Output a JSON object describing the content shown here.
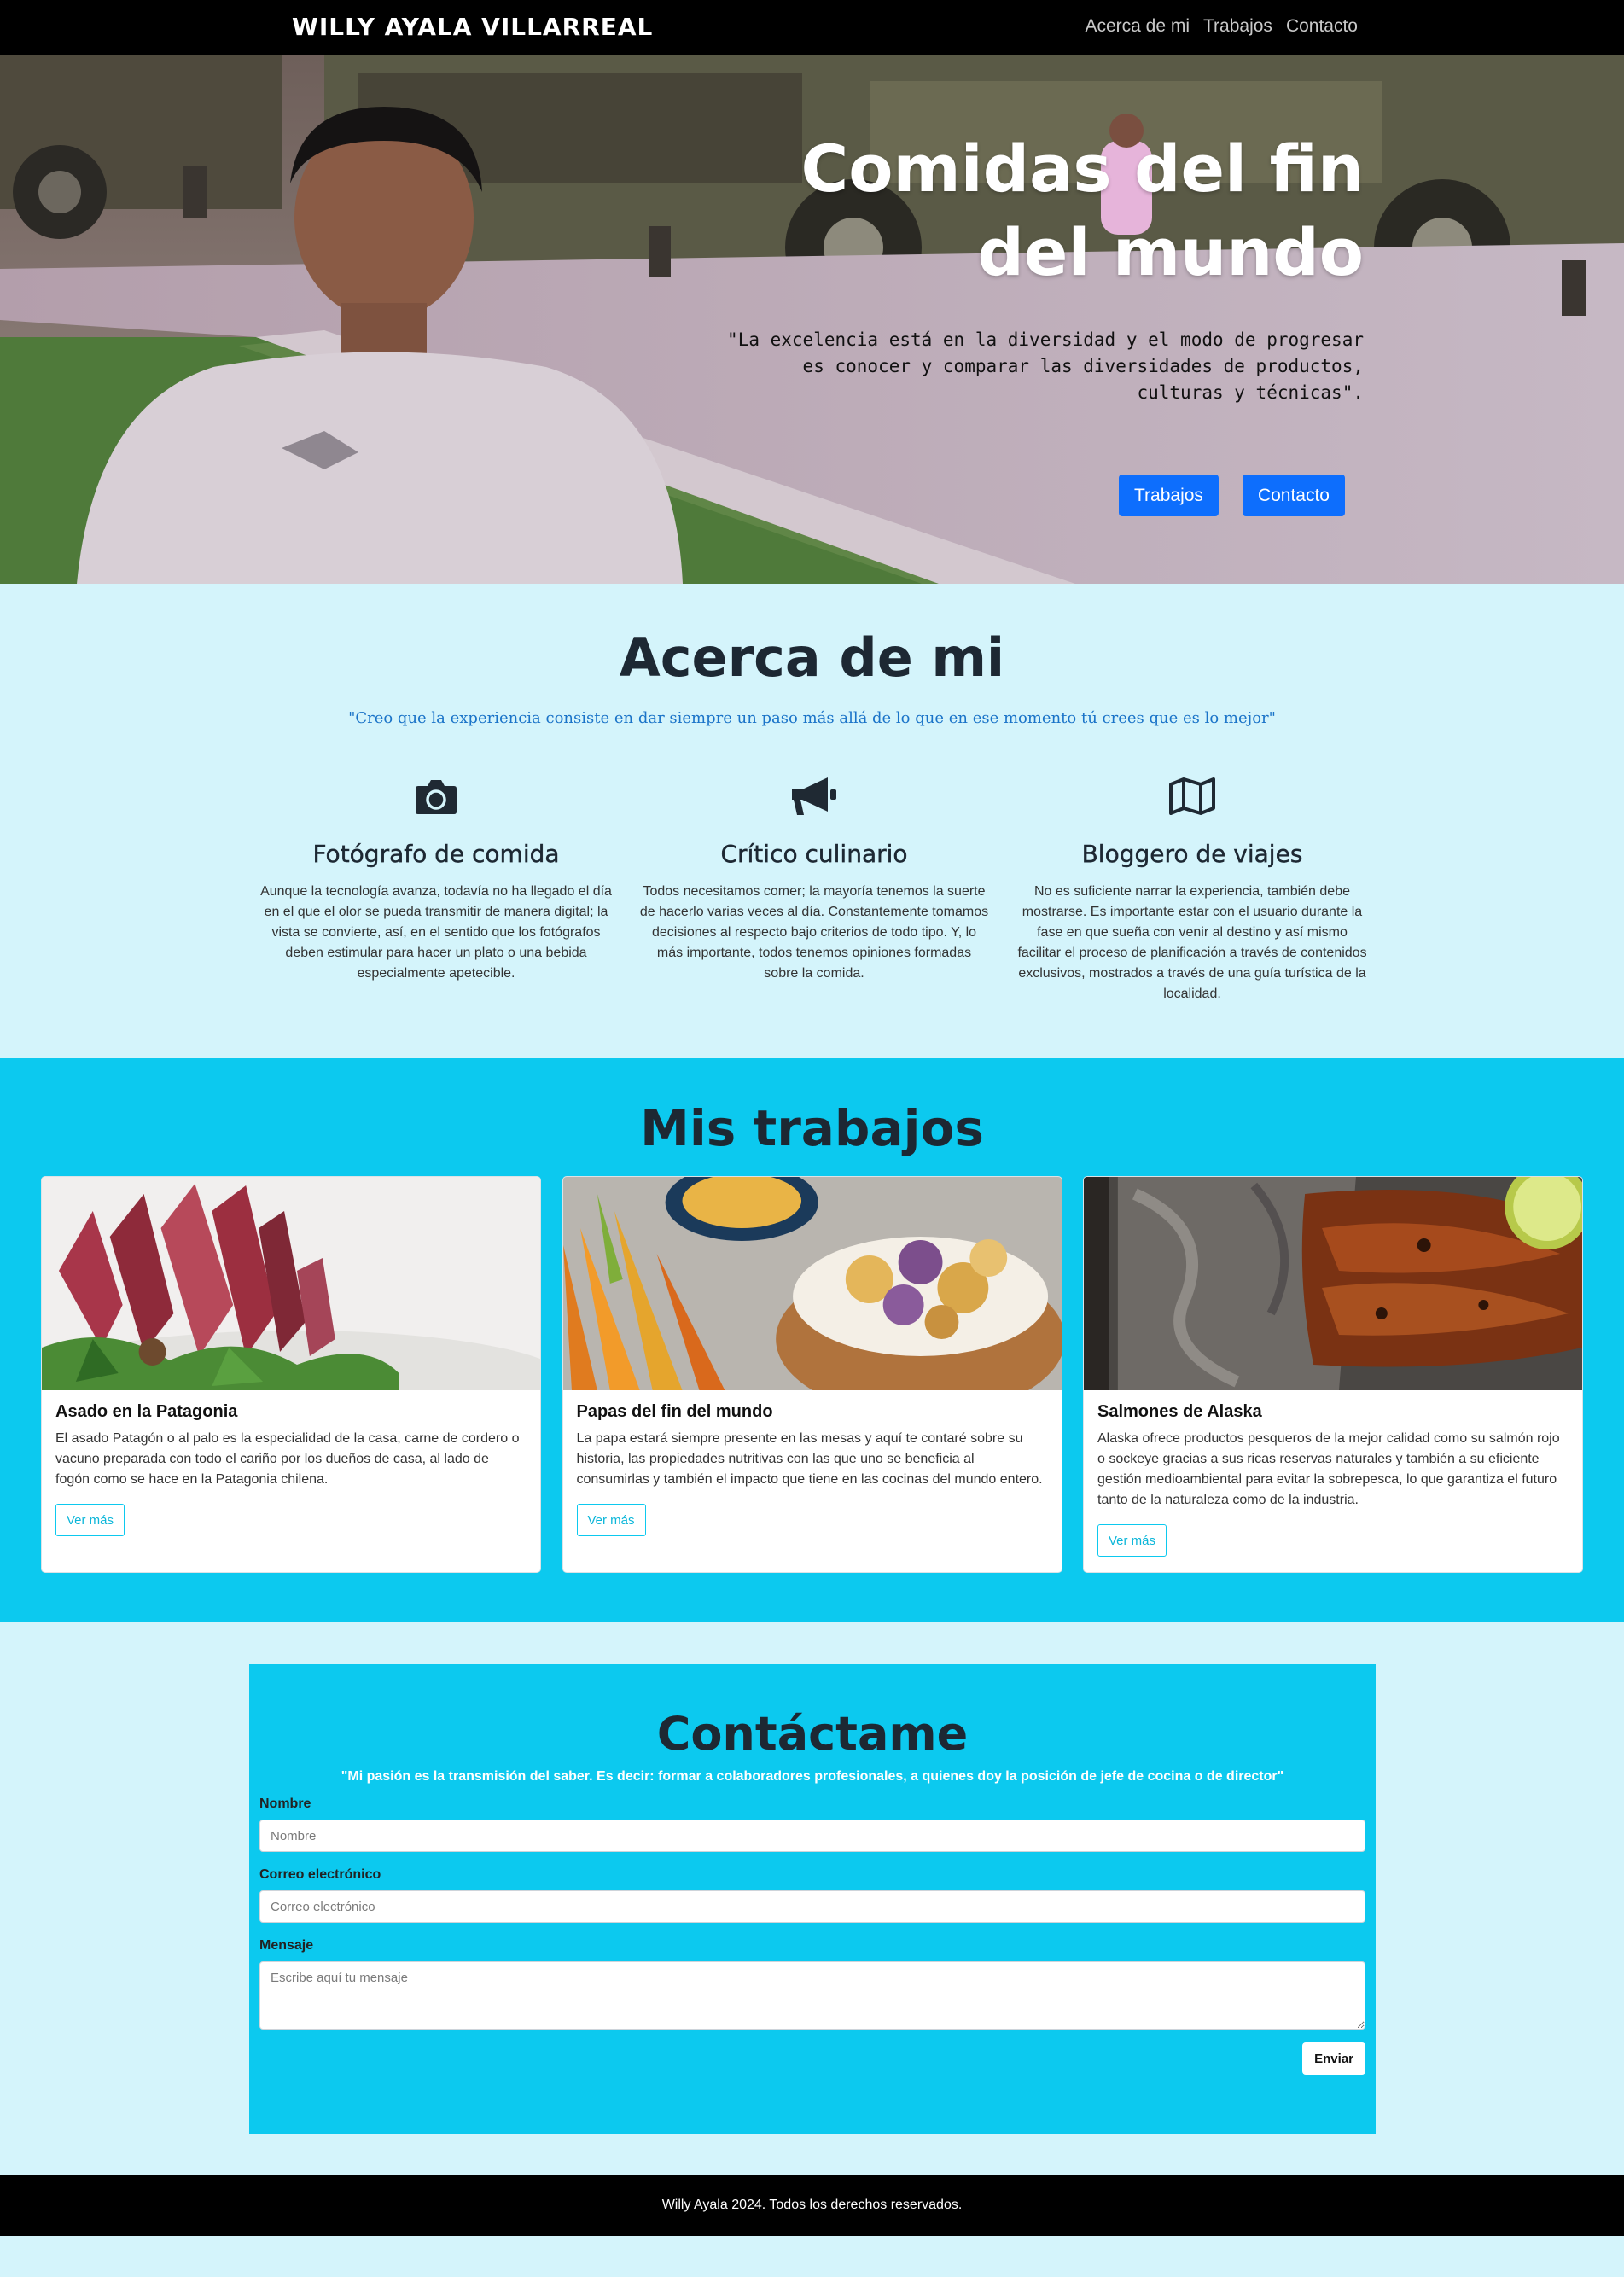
{
  "navbar": {
    "brand": "WILLY AYALA VILLARREAL",
    "links": [
      "Acerca de mi",
      "Trabajos",
      "Contacto"
    ]
  },
  "hero": {
    "title": "Comidas del fin del mundo",
    "quote": "\"La excelencia está en la diversidad y el modo de progresar es conocer y comparar las diversidades de productos, culturas y técnicas\".",
    "buttons": [
      "Trabajos",
      "Contacto"
    ]
  },
  "about": {
    "title": "Acerca de mi",
    "quote": "\"Creo que la experiencia consiste en dar siempre un paso más allá de lo que en ese momento tú crees que es lo mejor\"",
    "items": [
      {
        "icon": "camera-icon",
        "title": "Fotógrafo de comida",
        "text": "Aunque la tecnología avanza, todavía no ha llegado el día en el que el olor se pueda transmitir de manera digital; la vista se convierte, así, en el sentido que los fotógrafos deben estimular para hacer un plato o una bebida especialmente apetecible."
      },
      {
        "icon": "megaphone-icon",
        "title": "Crítico culinario",
        "text": "Todos necesitamos comer; la mayoría tenemos la suerte de hacerlo varias veces al día. Constantemente tomamos decisiones al respecto bajo criterios de todo tipo. Y, lo más importante, todos tenemos opiniones formadas sobre la comida."
      },
      {
        "icon": "map-icon",
        "title": "Bloggero de viajes",
        "text": "No es suficiente narrar la experiencia, también debe mostrarse. Es importante estar con el usuario durante la fase en que sueña con venir al destino y así mismo facilitar el proceso de planificación a través de contenidos exclusivos, mostrados a través de una guía turística de la localidad."
      }
    ]
  },
  "works": {
    "title": "Mis trabajos",
    "cards": [
      {
        "title": "Asado en la Patagonia",
        "text": "El asado Patagón o al palo es la especialidad de la casa, carne de cordero o vacuno preparada con todo el cariño por los dueños de casa, al lado de fogón como se hace en la Patagonia chilena.",
        "button": "Ver más"
      },
      {
        "title": "Papas del fin del mundo",
        "text": "La papa estará siempre presente en las mesas y aquí te contaré sobre su historia, las propiedades nutritivas con las que uno se beneficia al consumirlas y también el impacto que tiene en las cocinas del mundo entero.",
        "button": "Ver más"
      },
      {
        "title": "Salmones de Alaska",
        "text": "Alaska ofrece productos pesqueros de la mejor calidad como su salmón rojo o sockeye gracias a sus ricas reservas naturales y también a su eficiente gestión medioambiental para evitar la sobrepesca, lo que garantiza el futuro tanto de la naturaleza como de la industria.",
        "button": "Ver más"
      }
    ]
  },
  "contact": {
    "title": "Contáctame",
    "quote": "\"Mi pasión es la transmisión del saber. Es decir: formar a colaboradores profesionales, a quienes doy la posición de jefe de cocina o de director\"",
    "name_label": "Nombre",
    "name_placeholder": "Nombre",
    "email_label": "Correo electrónico",
    "email_placeholder": "Correo electrónico",
    "message_label": "Mensaje",
    "message_placeholder": "Escribe aquí tu mensaje",
    "submit": "Enviar"
  },
  "footer": {
    "text": "Willy Ayala 2024. Todos los derechos reservados."
  }
}
